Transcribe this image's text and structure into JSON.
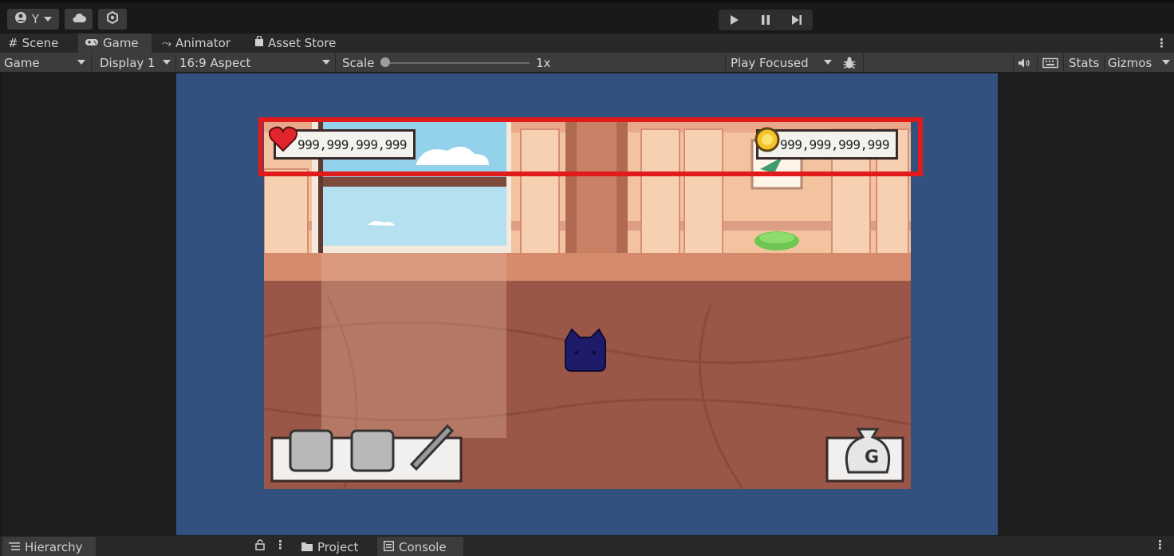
{
  "toolbar": {
    "account_label": "Y",
    "icons": {
      "account": "account-icon",
      "cloud": "cloud-icon",
      "collab": "collab-icon",
      "play": "play-icon",
      "pause": "pause-icon",
      "step": "step-icon"
    }
  },
  "tabs": [
    {
      "icon": "#",
      "label": "Scene"
    },
    {
      "icon": "⌬",
      "label": "Game"
    },
    {
      "icon": "⤳",
      "label": "Animator"
    },
    {
      "icon": "🔒",
      "label": "Asset Store"
    }
  ],
  "game_toolbar": {
    "view_mode": "Game",
    "display": "Display 1",
    "aspect": "16:9 Aspect",
    "scale_label": "Scale",
    "scale_value": "1x",
    "scale_fraction": 0.0,
    "play_mode": "Play Focused",
    "stats": "Stats",
    "gizmos": "Gizmos"
  },
  "game": {
    "hp_counter": "999,999,999,999",
    "gold_counter": "999,999,999,999",
    "colors": {
      "highlight": "#e11b1b",
      "letterbox": "#32517e",
      "wall": "#f2c39e",
      "floor": "#9a5646",
      "cat": "#1e1b6b"
    }
  },
  "bottom_tabs": {
    "hierarchy": "Hierarchy",
    "project": "Project",
    "console": "Console"
  }
}
